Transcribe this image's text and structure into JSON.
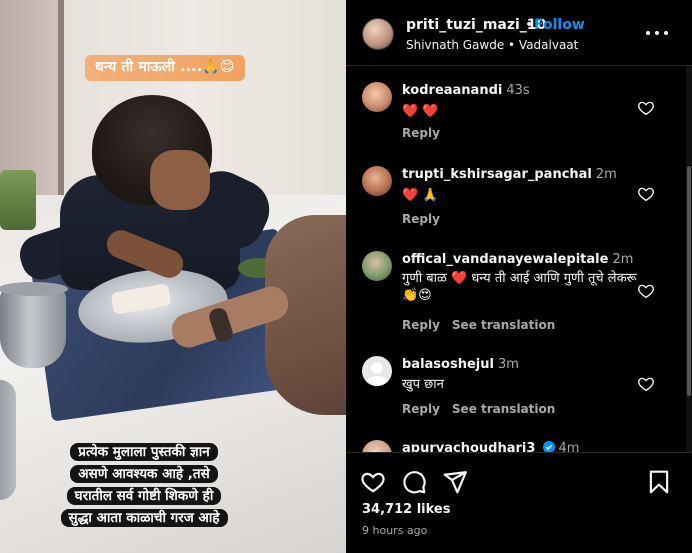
{
  "media": {
    "caption_top": "धन्य ती माऊली ....🙏😊",
    "caption_bottom_lines": [
      "प्रत्येक मुलाला पुस्तकी ज्ञान",
      "असणे आवश्यक आहे ,तसे",
      "घरातील सर्व गोष्टी शिकणे ही",
      "सुद्धा आता काळाची गरज आहे"
    ]
  },
  "header": {
    "username": "priti_tuzi_mazi_10",
    "separator": "•",
    "follow_label": "Follow",
    "subtitle": "Shivnath Gawde • Vadalvaat",
    "more_icon": "more-horizontal-icon"
  },
  "comments": [
    {
      "username": "kodreaanandi",
      "time": "43s",
      "body": "❤️ ❤️",
      "actions": [
        "Reply"
      ],
      "avatar_color": "#c98a6a"
    },
    {
      "username": "trupti_kshirsagar_panchal",
      "time": "2m",
      "body": "❤️ 🙏",
      "actions": [
        "Reply"
      ],
      "avatar_color": "#b86f4d"
    },
    {
      "username": "offical_vandanayewalepitale",
      "time": "2m",
      "body": "गुणी बाळ ❤️ धन्य ती आई आणि गुणी तूचे लेकरू 👏😍",
      "actions": [
        "Reply",
        "See translation"
      ],
      "avatar_color": "#7d9a6a"
    },
    {
      "username": "balasoshejul",
      "time": "3m",
      "body": "खुप छान",
      "actions": [
        "Reply",
        "See translation"
      ],
      "avatar_color": "#e8e8e8"
    },
    {
      "username": "apurvachoudhari3",
      "time": "4m",
      "body": "",
      "actions": [],
      "avatar_color": "#caa089"
    }
  ],
  "footer": {
    "likes": "34,712 likes",
    "time_ago": "9 hours ago",
    "icons": [
      "heart-icon",
      "comment-icon",
      "share-icon",
      "bookmark-icon"
    ]
  },
  "colors": {
    "accent": "#0095f6",
    "background": "#000000",
    "secondary_text": "#a8a8a8",
    "verified": "#0095f6"
  }
}
